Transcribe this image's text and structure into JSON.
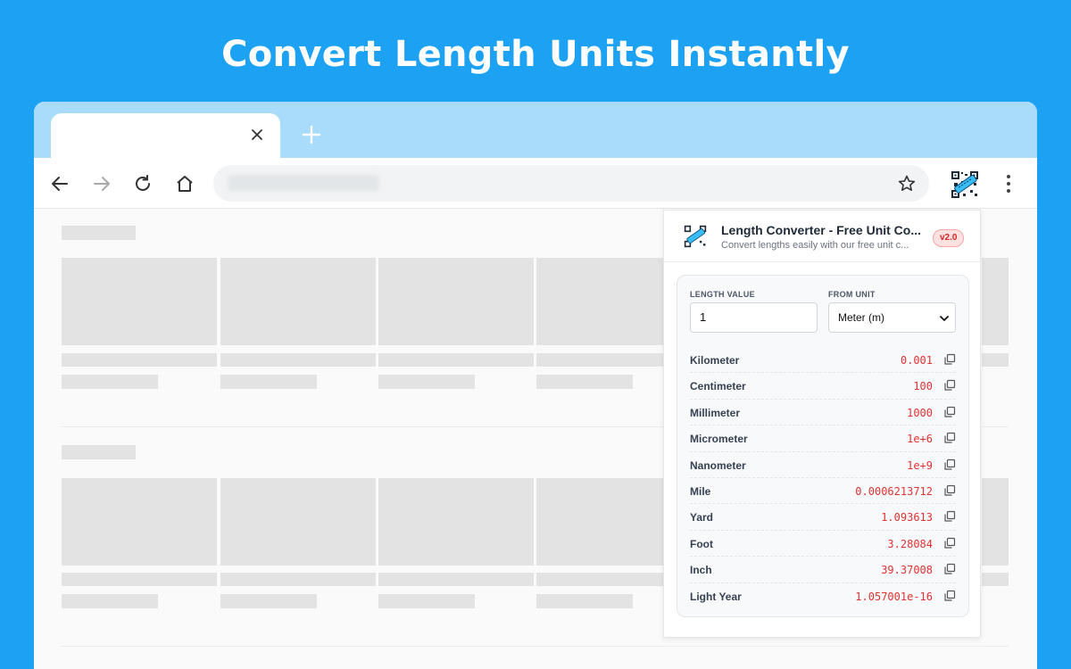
{
  "headline": "Convert Length Units Instantly",
  "browser": {
    "new_tab_symbol": "+",
    "nav_icons": [
      "back-arrow-icon",
      "forward-arrow-icon",
      "reload-icon",
      "home-icon"
    ],
    "bookmark_icon": "star-icon",
    "menu_icon": "kebab-menu-icon"
  },
  "popup": {
    "title": "Length Converter - Free Unit Co...",
    "subtitle": "Convert lengths easily with our free unit c...",
    "version": "v2.0",
    "length_label": "LENGTH VALUE",
    "length_value": "1",
    "from_label": "FROM UNIT",
    "from_value": "Meter (m)",
    "results": [
      {
        "label": "Kilometer",
        "value": "0.001"
      },
      {
        "label": "Centimeter",
        "value": "100"
      },
      {
        "label": "Millimeter",
        "value": "1000"
      },
      {
        "label": "Micrometer",
        "value": "1e+6"
      },
      {
        "label": "Nanometer",
        "value": "1e+9"
      },
      {
        "label": "Mile",
        "value": "0.0006213712"
      },
      {
        "label": "Yard",
        "value": "1.093613"
      },
      {
        "label": "Foot",
        "value": "3.28084"
      },
      {
        "label": "Inch",
        "value": "39.37008"
      },
      {
        "label": "Light Year",
        "value": "1.057001e-16"
      }
    ]
  },
  "colors": {
    "background": "#1da1f2",
    "tab_strip": "#a8dcfa",
    "result_value": "#e03131",
    "badge": "#dc2626"
  }
}
